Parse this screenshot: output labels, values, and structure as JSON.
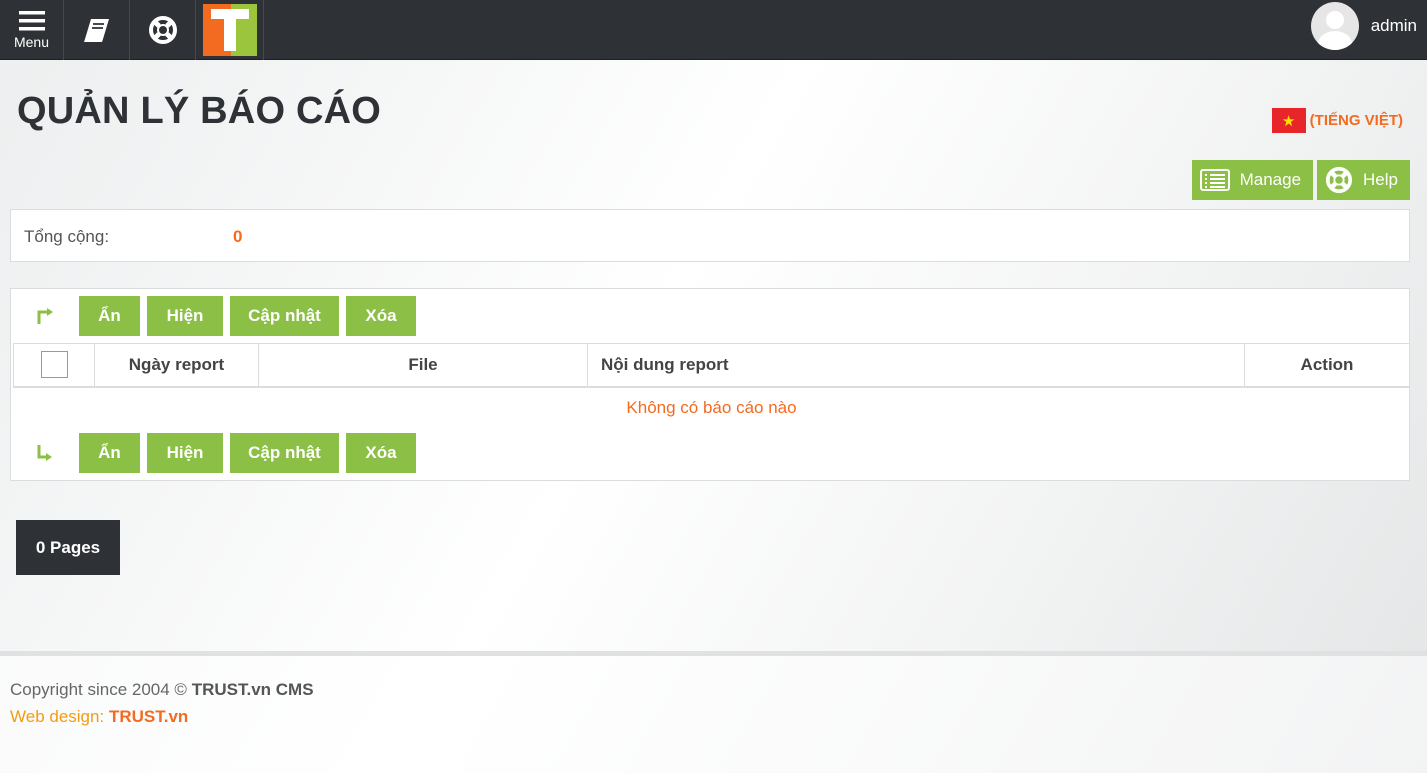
{
  "topbar": {
    "menu_label": "Menu",
    "logo_letter": "T",
    "username": "admin"
  },
  "page": {
    "title": "QUẢN LÝ BÁO CÁO",
    "language": "(TIẾNG VIỆT)",
    "manage_label": "Manage",
    "help_label": "Help"
  },
  "summary": {
    "total_label": "Tổng cộng:",
    "total_value": "0"
  },
  "actions": {
    "hide": "Ẩn",
    "show": "Hiện",
    "update": "Cập nhật",
    "delete": "Xóa"
  },
  "table": {
    "columns": [
      "Ngày report",
      "File",
      "Nội dung report",
      "Action"
    ],
    "empty_message": "Không có báo cáo nào"
  },
  "pagination": {
    "label": "0 Pages"
  },
  "footer": {
    "copyright_prefix": "Copyright since 2004 ©",
    "copyright_brand": "TRUST.vn CMS",
    "design_prefix": "Web design:",
    "design_brand": "TRUST.vn"
  },
  "colors": {
    "accent_green": "#8cbf45",
    "accent_orange": "#f36b21",
    "dark": "#2e3136"
  }
}
